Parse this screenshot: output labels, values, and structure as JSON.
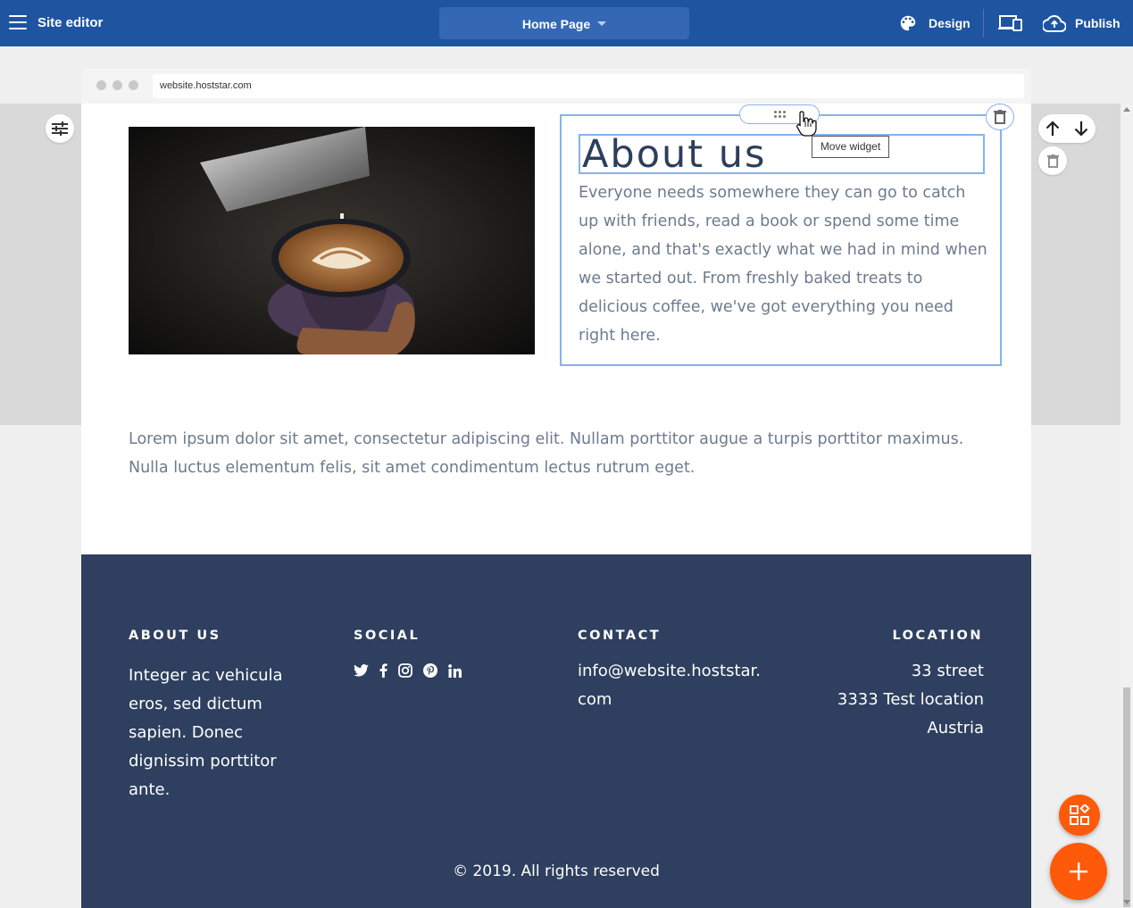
{
  "topbar": {
    "app_title": "Site editor",
    "page_selector": "Home Page",
    "design_label": "Design",
    "publish_label": "Publish"
  },
  "browser": {
    "url": "website.hoststar.com"
  },
  "about": {
    "heading": "About us",
    "body": "Everyone needs somewhere they can go to catch up with friends, read a book or spend some time alone, and that's exactly what we had in mind when we started out. From freshly baked treats to delicious coffee, we've got everything you need right here.",
    "tooltip": "Move widget"
  },
  "lorem": "Lorem ipsum dolor sit amet, consectetur adipiscing elit. Nullam porttitor augue a turpis porttitor maximus. Nulla luctus elementum felis, sit amet condimentum lectus rutrum eget.",
  "footer": {
    "about_heading": "ABOUT US",
    "about_text": "Integer ac vehicula eros, sed dictum sapien. Donec dignissim porttitor ante.",
    "social_heading": "SOCIAL",
    "social_icons": [
      "twitter-icon",
      "facebook-icon",
      "instagram-icon",
      "pinterest-icon",
      "linkedin-icon"
    ],
    "contact_heading": "CONTACT",
    "contact_email": "info@website.hoststar.com",
    "location_heading": "LOCATION",
    "location_street": "33 street",
    "location_city": "3333 Test location",
    "location_country": "Austria",
    "copyright": "© 2019. All rights reserved"
  },
  "colors": {
    "topbar": "#1e54a0",
    "footer": "#2e3f5f",
    "accent_orange": "#ff5a0a",
    "selection_blue": "#86b2ee"
  }
}
